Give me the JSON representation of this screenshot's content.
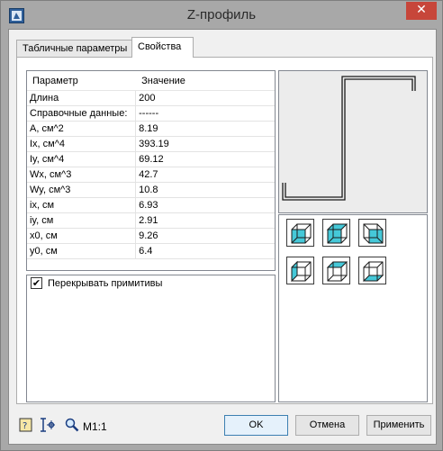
{
  "window": {
    "title": "Z-профиль",
    "close_glyph": "✕"
  },
  "tabs": [
    {
      "label": "Табличные параметры",
      "active": false
    },
    {
      "label": "Свойства",
      "active": true
    }
  ],
  "properties": {
    "header": {
      "param": "Параметр",
      "value": "Значение"
    },
    "rows": [
      {
        "param": "Длина",
        "value": "200"
      },
      {
        "param": "Справочные данные:",
        "value": "------"
      },
      {
        "param": "A, см^2",
        "value": "8.19"
      },
      {
        "param": "Ix, см^4",
        "value": "393.19"
      },
      {
        "param": "Iy, см^4",
        "value": "69.12"
      },
      {
        "param": "Wx, см^3",
        "value": "42.7"
      },
      {
        "param": "Wy, см^3",
        "value": "10.8"
      },
      {
        "param": "ix, см",
        "value": "6.93"
      },
      {
        "param": "iy, см",
        "value": "2.91"
      },
      {
        "param": "x0, см",
        "value": "9.26"
      },
      {
        "param": "y0, см",
        "value": "6.4"
      }
    ]
  },
  "options": {
    "overlap_label": "Перекрывать примитивы",
    "overlap_checked": true,
    "check_glyph": "✔"
  },
  "view_buttons": [
    "view-iso-front-left",
    "view-iso-front-top",
    "view-iso-front-right",
    "view-iso-left",
    "view-iso-top",
    "view-iso-right"
  ],
  "footer": {
    "scale_label": "M1:1",
    "ok_label": "OK",
    "cancel_label": "Отмена",
    "apply_label": "Применить"
  },
  "colors": {
    "accent_cyan": "#45c8d8",
    "titlebar": "#a8a8a8",
    "close": "#c7463a"
  }
}
